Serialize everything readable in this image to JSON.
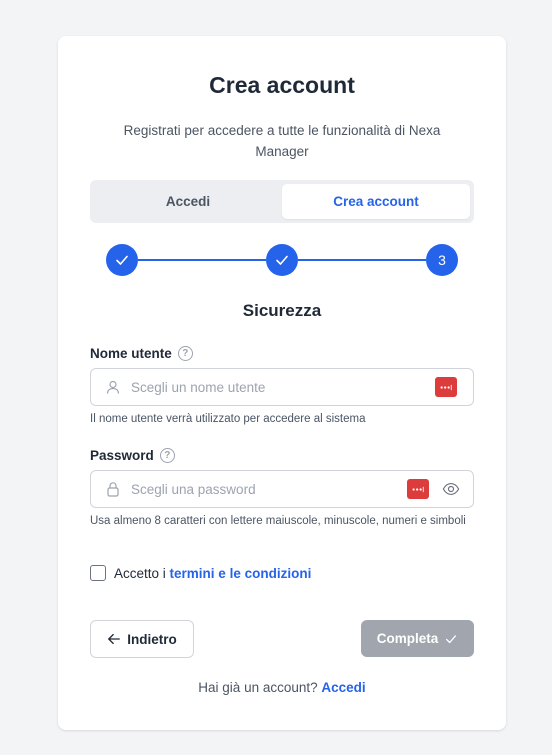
{
  "header": {
    "title": "Crea account",
    "subtitle": "Registrati per accedere a tutte le funzionalità di Nexa Manager"
  },
  "tabs": [
    {
      "label": "Accedi",
      "active": false
    },
    {
      "label": "Crea account",
      "active": true
    }
  ],
  "stepper": {
    "steps": [
      {
        "state": "done",
        "icon": "check-icon"
      },
      {
        "state": "done",
        "icon": "check-icon"
      },
      {
        "state": "current",
        "label": "3"
      }
    ],
    "accent": "#2563eb"
  },
  "section_title": "Sicurezza",
  "username": {
    "label": "Nome utente",
    "placeholder": "Scegli un nome utente",
    "value": "",
    "hint": "Il nome utente verrà utilizzato per accedere al sistema"
  },
  "password": {
    "label": "Password",
    "placeholder": "Scegli una password",
    "value": "",
    "hint": "Usa almeno 8 caratteri con lettere maiuscole, minuscole, numeri e simboli"
  },
  "terms": {
    "prefix": "Accetto i",
    "link": "termini e le condizioni",
    "checked": false
  },
  "buttons": {
    "back": "Indietro",
    "complete": "Completa"
  },
  "footer": {
    "prompt": "Hai già un account?",
    "link": "Accedi"
  }
}
